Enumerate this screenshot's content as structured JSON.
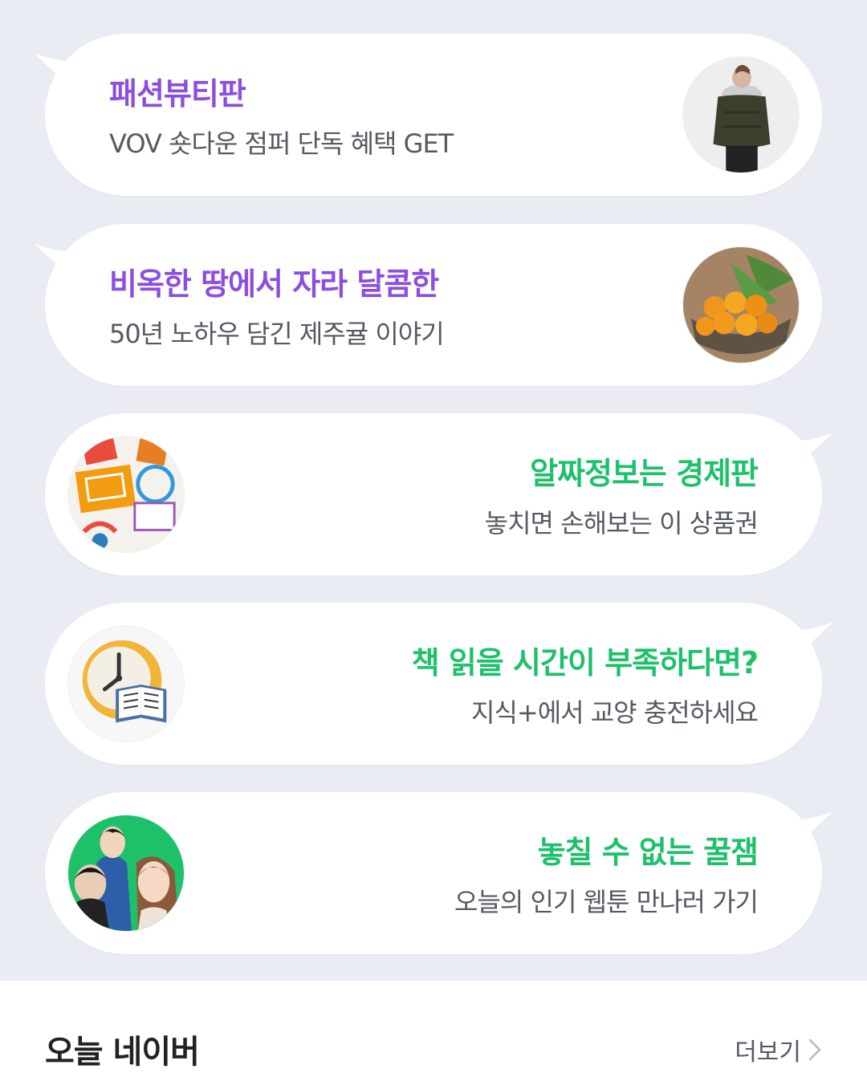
{
  "cards": [
    {
      "title": "패션뷰티판",
      "subtitle": "VOV 숏다운 점퍼 단독 혜택 GET",
      "title_color": "#8b4ee0",
      "image_icon": "puffer-jacket-model-image"
    },
    {
      "title": "비옥한 땅에서 자라 달콤한",
      "subtitle": "50년 노하우 담긴 제주귤 이야기",
      "title_color": "#8b4ee0",
      "image_icon": "tangerine-basket-image"
    },
    {
      "title": "알짜정보는 경제판",
      "subtitle": "놓치면 손해보는 이 상품권",
      "title_color": "#1ec16a",
      "image_icon": "sale-coupon-image"
    },
    {
      "title": "책 읽을 시간이 부족하다면?",
      "subtitle": "지식+에서 교양 충전하세요",
      "title_color": "#1ec16a",
      "image_icon": "clock-book-image"
    },
    {
      "title": "놓칠 수 없는 꿀잼",
      "subtitle": "오늘의 인기 웹툰 만나러 가기",
      "title_color": "#1ec16a",
      "image_icon": "webtoon-characters-image"
    }
  ],
  "section": {
    "title": "오늘 네이버",
    "more_label": "더보기",
    "more_icon": "chevron-right-icon"
  }
}
